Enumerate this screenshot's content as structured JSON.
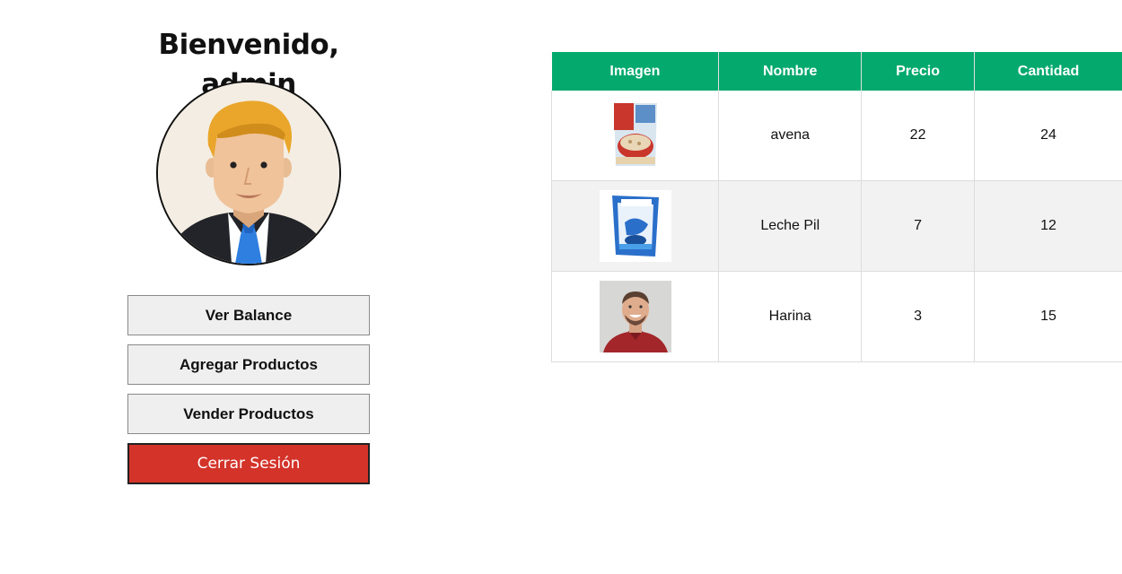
{
  "welcome": "Bienvenido, admin",
  "buttons": {
    "balance": "Ver Balance",
    "add": "Agregar Productos",
    "sell": "Vender Productos",
    "logout": "Cerrar Sesión"
  },
  "table": {
    "headers": [
      "Imagen",
      "Nombre",
      "Precio",
      "Cantidad"
    ],
    "rows": [
      {
        "nombre": "avena",
        "precio": "22",
        "cantidad": "24"
      },
      {
        "nombre": "Leche Pil",
        "precio": "7",
        "cantidad": "12"
      },
      {
        "nombre": "Harina",
        "precio": "3",
        "cantidad": "15"
      }
    ]
  },
  "colors": {
    "header": "#04aa6d",
    "logout": "#d4332a",
    "row_alt": "#f2f2f2"
  }
}
